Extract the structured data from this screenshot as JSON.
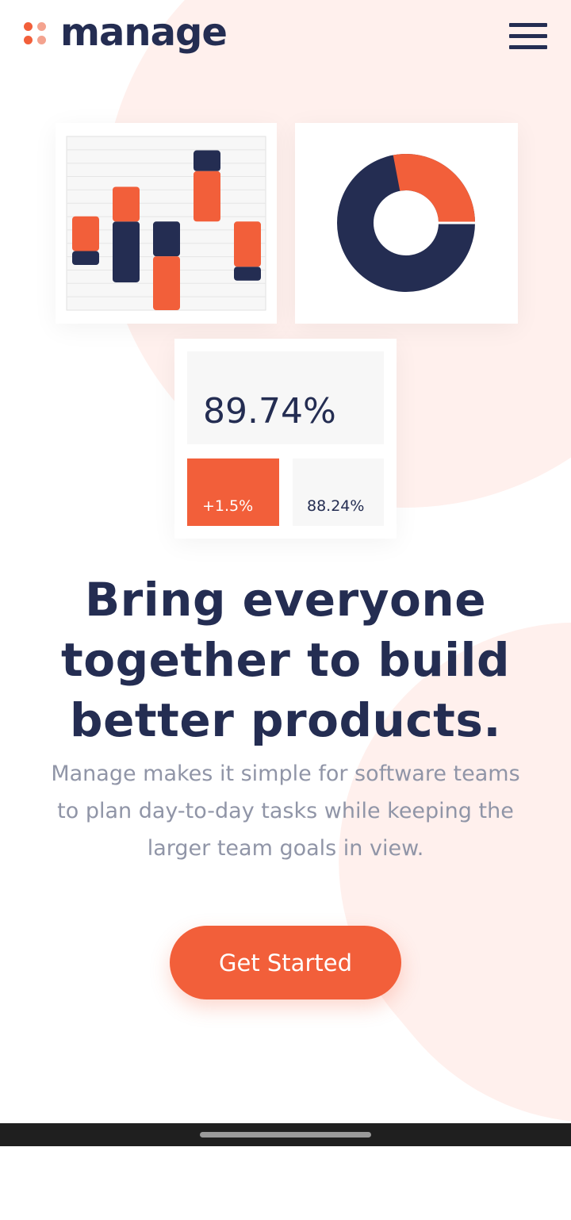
{
  "brand": {
    "name": "manage",
    "accent": "#f25f3a",
    "navy": "#242d52"
  },
  "header": {
    "menu_icon": "hamburger-menu-icon"
  },
  "stats": {
    "main": "89.74%",
    "change": "+1.5%",
    "secondary": "88.24%"
  },
  "hero": {
    "headline": "Bring everyone together to build better products.",
    "description": "Manage makes it simple for software teams to plan day-to-day tasks while keeping the larger team goals in view.",
    "cta_label": "Get Started"
  },
  "illustration": {
    "bars": [
      {
        "orange": [
          0.46,
          0.66
        ],
        "navy": [
          0.66,
          0.74
        ]
      },
      {
        "orange": [
          0.29,
          0.49
        ],
        "navy": [
          0.49,
          0.84
        ]
      },
      {
        "orange": [
          0.69,
          1.0
        ],
        "navy": [
          0.49,
          0.69
        ]
      },
      {
        "orange": [
          0.2,
          0.49
        ],
        "navy": [
          0.08,
          0.2
        ]
      },
      {
        "orange": [
          0.49,
          0.75
        ],
        "navy": [
          0.75,
          0.83
        ]
      }
    ],
    "donut_orange_share": 0.28
  }
}
